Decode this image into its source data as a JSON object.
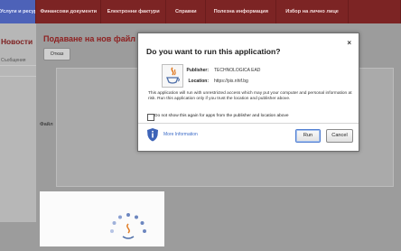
{
  "nav": {
    "items": [
      "Услуги и ресурси",
      "Финансови документи",
      "Електронни фактури",
      "Справки",
      "Полезна информация",
      "Избор на лично лице"
    ]
  },
  "left_panel": {
    "title": "Новости",
    "subtitle": "Съобщения"
  },
  "page": {
    "heading": "Подаване на нов файл",
    "cancel_label": "Отказ",
    "file_label": "Файл"
  },
  "dialog": {
    "title": "Do you want to run this application?",
    "close_glyph": "×",
    "publisher_label": "Publisher:",
    "publisher_value": "TECHNOLOGICA EAD",
    "location_label": "Location:",
    "location_value": "https://pis.nhif.bg",
    "warning": "This application will run with unrestricted access which may put your computer and personal information at risk. Run this application only if you trust the location and publisher above.",
    "checkbox_label": "Do not show this again for apps from the publisher and location above",
    "more_info": "More Information",
    "run_label": "Run",
    "cancel_label": "Cancel"
  },
  "colors": {
    "nav_bg": "#7c2424",
    "nav_active": "#4d62b8",
    "heading": "#8e2020",
    "java_blue": "#4d6ea8",
    "java_orange": "#e07a22"
  },
  "icons": [
    "java-icon",
    "shield-info-icon",
    "close-icon",
    "loading-spinner-icon"
  ]
}
